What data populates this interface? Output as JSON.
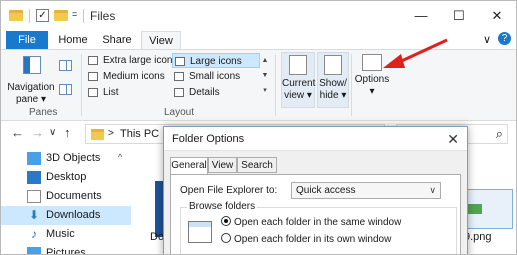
{
  "window": {
    "title": "Files",
    "minimize": "—",
    "maximize": "☐",
    "close": "✕"
  },
  "ribbon_tabs": {
    "file": "File",
    "home": "Home",
    "share": "Share",
    "view": "View",
    "expand": "∨",
    "help": "?"
  },
  "ribbon": {
    "panes": {
      "navigation_pane": "Navigation pane ▾",
      "group_label": "Panes"
    },
    "layout": {
      "items": [
        {
          "label": "Extra large icons",
          "selected": false
        },
        {
          "label": "Large icons",
          "selected": true
        },
        {
          "label": "Medium icons",
          "selected": false
        },
        {
          "label": "Small icons",
          "selected": false
        },
        {
          "label": "List",
          "selected": false
        },
        {
          "label": "Details",
          "selected": false
        }
      ],
      "group_label": "Layout"
    },
    "current_view": "Current view ▾",
    "show_hide": "Show/ hide ▾",
    "options": "Options",
    "options_arrow": "▾"
  },
  "address": {
    "back": "←",
    "forward": "→",
    "up_down": "∨",
    "up": "↑",
    "path": "This PC",
    "sep": ">",
    "search_icon": "⌕"
  },
  "tree": {
    "items": [
      {
        "label": "3D Objects",
        "selected": false,
        "color": "#4aa0e6"
      },
      {
        "label": "Desktop",
        "selected": false,
        "color": "#2a78c8"
      },
      {
        "label": "Documents",
        "selected": false,
        "color": "#8a8a8a"
      },
      {
        "label": "Downloads",
        "selected": true,
        "color": "#2a78c8"
      },
      {
        "label": "Music",
        "selected": false,
        "color": "#2a78c8"
      },
      {
        "label": "Pictures",
        "selected": false,
        "color": "#4aa0e6"
      }
    ],
    "expander": "^"
  },
  "content": {
    "partial_label_left": "Do",
    "partial_label_right": "9.png"
  },
  "dialog": {
    "title": "Folder Options",
    "close": "✕",
    "tabs": [
      "General",
      "View",
      "Search"
    ],
    "open_label": "Open File Explorer to:",
    "open_value": "Quick access",
    "browse_legend": "Browse folders",
    "radio_same": "Open each folder in the same window",
    "radio_own": "Open each folder in its own window",
    "selected_radio": "same"
  },
  "colors": {
    "accent": "#1979ca",
    "selection": "#cce8ff",
    "arrow": "#e0201b"
  }
}
